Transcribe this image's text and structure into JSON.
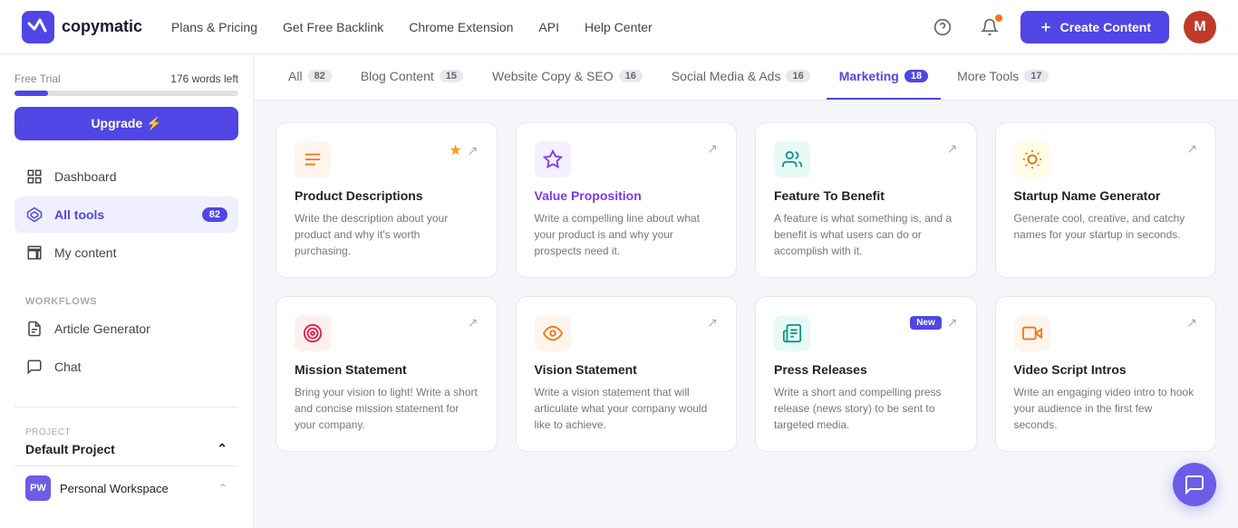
{
  "nav": {
    "logo_text": "copymatic",
    "links": [
      {
        "label": "Plans & Pricing",
        "id": "plans"
      },
      {
        "label": "Get Free Backlink",
        "id": "backlink"
      },
      {
        "label": "Chrome Extension",
        "id": "extension"
      },
      {
        "label": "API",
        "id": "api"
      },
      {
        "label": "Help Center",
        "id": "help"
      }
    ],
    "create_label": "Create Content"
  },
  "sidebar": {
    "trial_label": "Free Trial",
    "words_label": "176 words left",
    "upgrade_label": "Upgrade ⚡",
    "items": [
      {
        "label": "Dashboard",
        "icon": "🏠",
        "id": "dashboard"
      },
      {
        "label": "All tools",
        "icon": "◈",
        "id": "alltools",
        "badge": "82",
        "active": true
      },
      {
        "label": "My content",
        "icon": "📁",
        "id": "mycontent"
      }
    ],
    "workflows_label": "Workflows",
    "workflow_items": [
      {
        "label": "Article Generator",
        "icon": "📄",
        "id": "article"
      },
      {
        "label": "Chat",
        "icon": "💬",
        "id": "chat"
      }
    ],
    "project_label": "PROJECT",
    "project_name": "Default Project",
    "workspace_initials": "PW",
    "workspace_name": "Personal Workspace"
  },
  "tabs": [
    {
      "label": "All",
      "count": "82",
      "id": "all"
    },
    {
      "label": "Blog Content",
      "count": "15",
      "id": "blog"
    },
    {
      "label": "Website Copy & SEO",
      "count": "16",
      "id": "website"
    },
    {
      "label": "Social Media & Ads",
      "count": "16",
      "id": "social"
    },
    {
      "label": "Marketing",
      "count": "18",
      "id": "marketing",
      "active": true
    },
    {
      "label": "More Tools",
      "count": "17",
      "id": "more"
    }
  ],
  "cards": [
    {
      "id": "product-descriptions",
      "title": "Product Descriptions",
      "desc": "Write the description about your product and why it's worth purchasing.",
      "icon": "≡",
      "icon_color": "orange",
      "starred": true,
      "new": false,
      "purple_title": false
    },
    {
      "id": "value-proposition",
      "title": "Value Proposition",
      "desc": "Write a compelling line about what your product is and why your prospects need it.",
      "icon": "💎",
      "icon_color": "purple",
      "starred": false,
      "new": false,
      "purple_title": true
    },
    {
      "id": "feature-to-benefit",
      "title": "Feature To Benefit",
      "desc": "A feature is what something is, and a benefit is what users can do or accomplish with it.",
      "icon": "🤝",
      "icon_color": "teal",
      "starred": false,
      "new": false,
      "purple_title": false
    },
    {
      "id": "startup-name-generator",
      "title": "Startup Name Generator",
      "desc": "Generate cool, creative, and catchy names for your startup in seconds.",
      "icon": "💡",
      "icon_color": "yellow",
      "starred": false,
      "new": false,
      "purple_title": false
    },
    {
      "id": "mission-statement",
      "title": "Mission Statement",
      "desc": "Bring your vision to light! Write a short and concise mission statement for your company.",
      "icon": "🎯",
      "icon_color": "red",
      "starred": false,
      "new": false,
      "purple_title": false
    },
    {
      "id": "vision-statement",
      "title": "Vision Statement",
      "desc": "Write a vision statement that will articulate what your company would like to achieve.",
      "icon": "👁",
      "icon_color": "orange",
      "starred": false,
      "new": false,
      "purple_title": false
    },
    {
      "id": "press-releases",
      "title": "Press Releases",
      "desc": "Write a short and compelling press release (news story) to be sent to targeted media.",
      "icon": "📰",
      "icon_color": "teal",
      "starred": false,
      "new": true,
      "purple_title": false
    },
    {
      "id": "video-script-intros",
      "title": "Video Script Intros",
      "desc": "Write an engaging video intro to hook your audience in the first few seconds.",
      "icon": "🎬",
      "icon_color": "orange",
      "starred": false,
      "new": false,
      "purple_title": false
    }
  ]
}
